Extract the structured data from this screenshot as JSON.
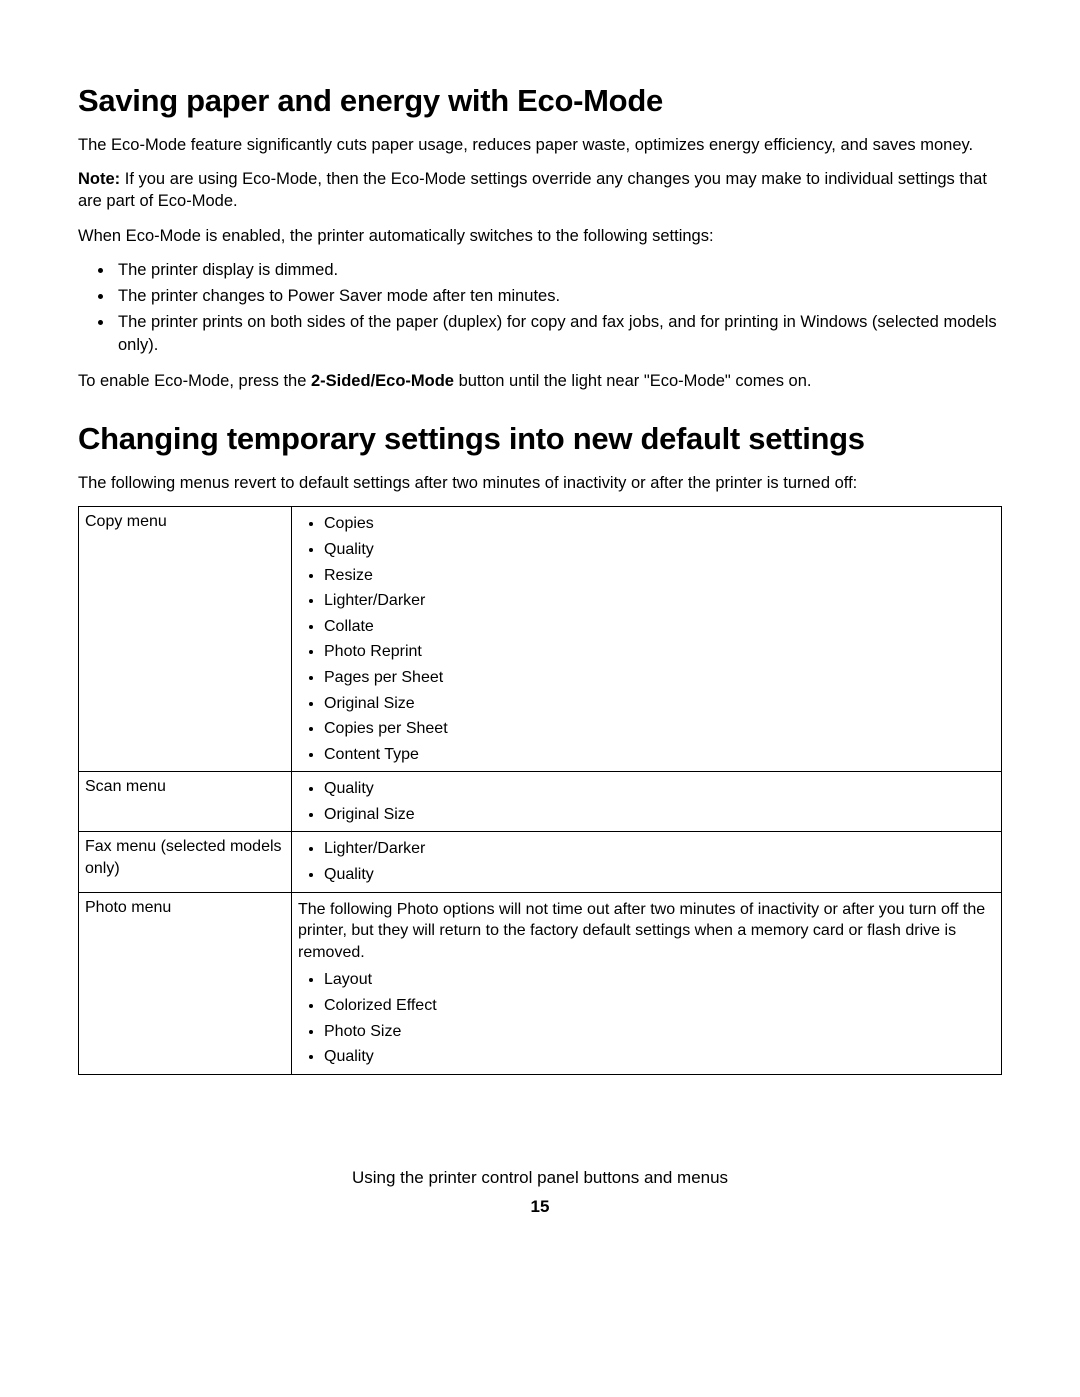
{
  "heading1": "Saving paper and energy with Eco-Mode",
  "p1": "The Eco-Mode feature significantly cuts paper usage, reduces paper waste, optimizes energy efficiency, and saves money.",
  "note_label": "Note:",
  "p2": " If you are using Eco-Mode, then the Eco-Mode settings override any changes you may make to individual settings that are part of Eco-Mode.",
  "p3": "When Eco-Mode is enabled, the printer automatically switches to the following settings:",
  "eco_list": {
    "i0": "The printer display is dimmed.",
    "i1": "The printer changes to Power Saver mode after ten minutes.",
    "i2": "The printer prints on both sides of the paper (duplex) for copy and fax jobs, and for printing in Windows (selected models only)."
  },
  "p4a": "To enable Eco-Mode, press the ",
  "p4b": "2-Sided/Eco-Mode",
  "p4c": " button until the light near \"Eco-Mode\" comes on.",
  "heading2": "Changing temporary settings into new default settings",
  "p5": "The following menus revert to default settings after two minutes of inactivity or after the printer is turned off:",
  "table": {
    "row0": {
      "label": "Copy menu",
      "items": {
        "i0": "Copies",
        "i1": "Quality",
        "i2": "Resize",
        "i3": "Lighter/Darker",
        "i4": "Collate",
        "i5": "Photo Reprint",
        "i6": "Pages per Sheet",
        "i7": "Original Size",
        "i8": "Copies per Sheet",
        "i9": "Content Type"
      }
    },
    "row1": {
      "label": "Scan menu",
      "items": {
        "i0": "Quality",
        "i1": "Original Size"
      }
    },
    "row2": {
      "label": "Fax menu (selected models only)",
      "items": {
        "i0": "Lighter/Darker",
        "i1": "Quality"
      }
    },
    "row3": {
      "label": "Photo menu",
      "note": "The following Photo options will not time out after two minutes of inactivity or after you turn off the printer, but they will return to the factory default settings when a memory card or flash drive is removed.",
      "items": {
        "i0": "Layout",
        "i1": "Colorized Effect",
        "i2": "Photo Size",
        "i3": "Quality"
      }
    }
  },
  "footer_chapter": "Using the printer control panel buttons and menus",
  "footer_page": "15"
}
